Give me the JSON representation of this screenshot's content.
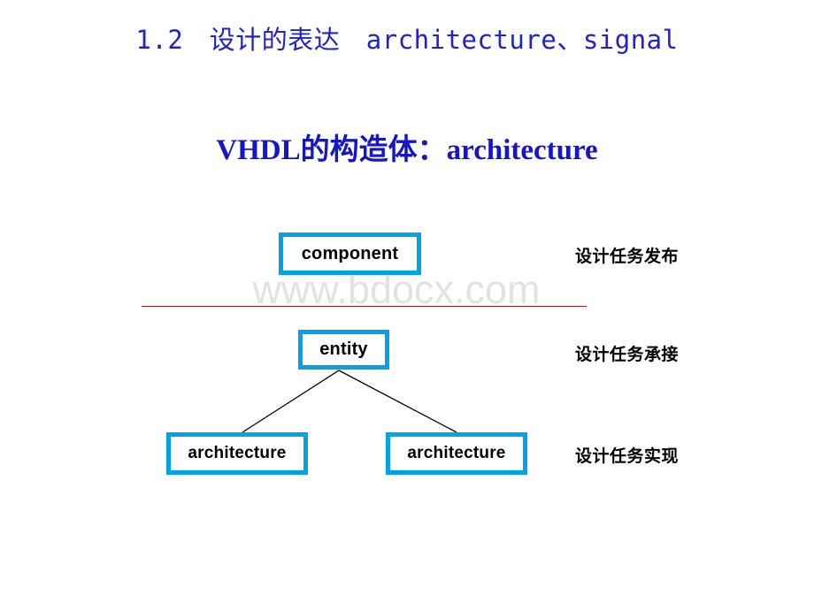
{
  "slide": {
    "title": "1.2　设计的表达　architecture、signal",
    "subtitle": "VHDL的构造体：architecture",
    "watermark": "www.bdocx.com",
    "background_color": "#FFFFFF",
    "title_color": "#2222CC",
    "subtitle_color": "#1515CC",
    "divider_color": "#A82020",
    "box_border_color": "#00A2EA",
    "watermark_color": "#E2E2E2"
  },
  "diagram": {
    "nodes": [
      {
        "id": "component",
        "label": "component"
      },
      {
        "id": "entity",
        "label": "entity"
      },
      {
        "id": "architecture_left",
        "label": "architecture"
      },
      {
        "id": "architecture_right",
        "label": "architecture"
      }
    ],
    "edges": [
      {
        "from": "entity",
        "to": "architecture_left"
      },
      {
        "from": "entity",
        "to": "architecture_right"
      }
    ]
  },
  "stage_labels": [
    {
      "id": "publish",
      "text": "设计任务发布"
    },
    {
      "id": "accept",
      "text": "设计任务承接"
    },
    {
      "id": "realize",
      "text": "设计任务实现"
    }
  ]
}
